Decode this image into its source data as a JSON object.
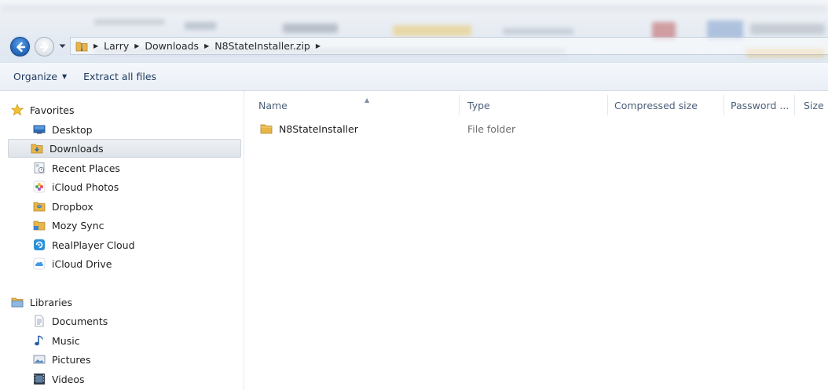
{
  "address_bar": {
    "crumbs": [
      "Larry",
      "Downloads",
      "N8StateInstaller.zip"
    ]
  },
  "command_bar": {
    "organize_label": "Organize",
    "extract_label": "Extract all files"
  },
  "nav_pane": {
    "favorites": {
      "label": "Favorites",
      "items": [
        {
          "label": "Desktop",
          "icon": "desktop-icon"
        },
        {
          "label": "Downloads",
          "icon": "downloads-folder-icon",
          "selected": true
        },
        {
          "label": "Recent Places",
          "icon": "recent-places-icon"
        },
        {
          "label": "iCloud Photos",
          "icon": "icloud-photos-icon"
        },
        {
          "label": "Dropbox",
          "icon": "dropbox-icon"
        },
        {
          "label": "Mozy Sync",
          "icon": "mozy-sync-folder-icon"
        },
        {
          "label": "RealPlayer Cloud",
          "icon": "realplayer-cloud-icon"
        },
        {
          "label": "iCloud Drive",
          "icon": "icloud-drive-icon"
        }
      ]
    },
    "libraries": {
      "label": "Libraries",
      "items": [
        {
          "label": "Documents",
          "icon": "documents-icon"
        },
        {
          "label": "Music",
          "icon": "music-icon"
        },
        {
          "label": "Pictures",
          "icon": "pictures-icon"
        },
        {
          "label": "Videos",
          "icon": "videos-icon"
        }
      ]
    }
  },
  "file_list": {
    "columns": [
      "Name",
      "Type",
      "Compressed size",
      "Password ...",
      "Size"
    ],
    "sort_column": "Name",
    "rows": [
      {
        "name": "N8StateInstaller",
        "type": "File folder"
      }
    ]
  },
  "colors": {
    "selection": "#dfe4ea",
    "command_text": "#1e395b",
    "header_text": "#4c607a",
    "folder_yellow": "#e8b547"
  }
}
